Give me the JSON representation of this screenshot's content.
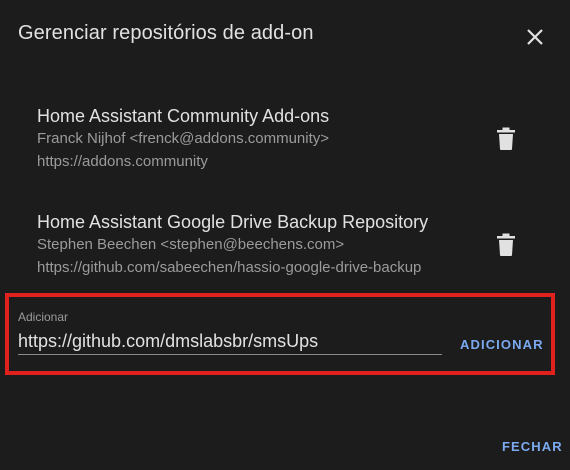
{
  "dialog": {
    "title": "Gerenciar repositórios de add-on",
    "close_icon": "close-icon"
  },
  "repositories": [
    {
      "name": "Home Assistant Community Add-ons",
      "maintainer": "Franck Nijhof <frenck@addons.community>",
      "url": "https://addons.community",
      "delete_icon": "trash-icon"
    },
    {
      "name": "Home Assistant Google Drive Backup Repository",
      "maintainer": "Stephen Beechen <stephen@beechens.com>",
      "url": "https://github.com/sabeechen/hassio-google-drive-backup",
      "delete_icon": "trash-icon"
    }
  ],
  "add_field": {
    "label": "Adicionar",
    "value": "https://github.com/dmslabsbr/smsUps",
    "button_label": "ADICIONAR"
  },
  "footer": {
    "close_label": "FECHAR"
  },
  "colors": {
    "background": "#1c1c1c",
    "accent": "#7baaf0",
    "highlight": "#e0211d"
  }
}
